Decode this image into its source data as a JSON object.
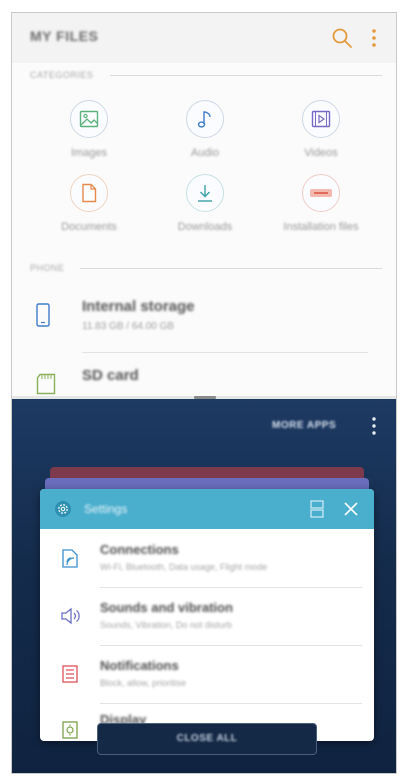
{
  "files": {
    "title": "MY FILES",
    "categories_label": "CATEGORIES",
    "categories": [
      {
        "label": "Images",
        "icon": "image-icon",
        "color": "#5bb17a"
      },
      {
        "label": "Audio",
        "icon": "music-note-icon",
        "color": "#3f7cc9"
      },
      {
        "label": "Videos",
        "icon": "video-icon",
        "color": "#7a68c6"
      },
      {
        "label": "Documents",
        "icon": "document-icon",
        "color": "#e58a4a"
      },
      {
        "label": "Downloads",
        "icon": "download-icon",
        "color": "#3aa0a8"
      },
      {
        "label": "Installation files",
        "icon": "apk-icon",
        "color": "#e06a5a"
      }
    ],
    "phone_label": "PHONE",
    "storage": [
      {
        "name": "Internal storage",
        "sub": "11.83 GB / 64.00 GB",
        "icon": "phone-icon"
      },
      {
        "name": "SD card",
        "sub": "",
        "icon": "sd-card-icon"
      }
    ]
  },
  "recents": {
    "more_apps": "MORE APPS",
    "settings_card": {
      "title": "Settings",
      "rows": [
        {
          "title": "Connections",
          "sub": "Wi-Fi, Bluetooth, Data usage, Flight mode",
          "icon": "connections-icon"
        },
        {
          "title": "Sounds and vibration",
          "sub": "Sounds, Vibration, Do not disturb",
          "icon": "speaker-icon"
        },
        {
          "title": "Notifications",
          "sub": "Block, allow, prioritise",
          "icon": "notifications-icon"
        },
        {
          "title": "Display",
          "sub": "",
          "icon": "display-icon"
        }
      ]
    },
    "close_all": "CLOSE ALL"
  },
  "colors": {
    "accent_teal": "#4aaecd",
    "recents_bg": "#142b4b",
    "icon_orange": "#e58a4a",
    "icon_blue": "#3f7cc9"
  }
}
